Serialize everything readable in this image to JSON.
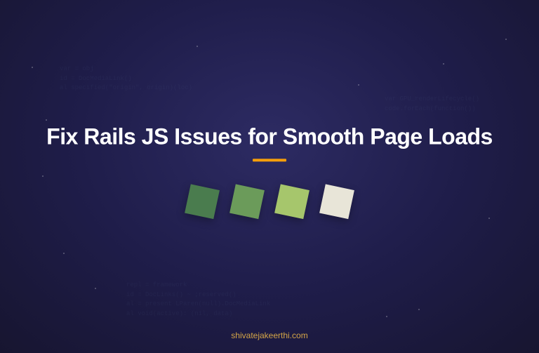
{
  "title": "Fix Rails JS Issues for Smooth Page Loads",
  "footer": "shivatejakeerthi.com",
  "bg_code_1": "var = obj\nid = DocMediaLink()\nal specified(\"origin\", origin)(loc)",
  "bg_code_2": "var GPU_renderLifecycle()\ncode.forEach(function())",
  "bg_code_3": "repl = framework\nid = DocLinks() ~ ;reserved()\nal = present LParen(null).DocMediaLink\nal void(active): (nil, data)",
  "squares": {
    "colors": [
      "#4a7c4e",
      "#6b9b5a",
      "#a6c66c",
      "#e8e5d8"
    ]
  },
  "accent_color": "#f59e0b"
}
